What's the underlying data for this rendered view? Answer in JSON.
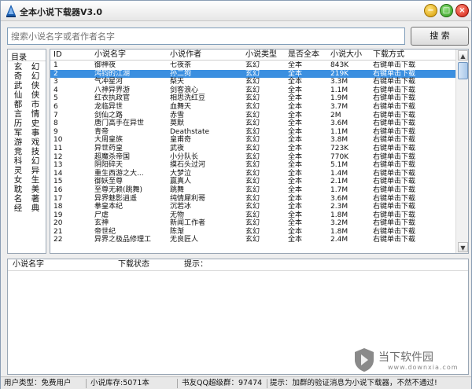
{
  "window": {
    "title": "全本小说下载器V3.0",
    "min_icon": "minimize-icon",
    "max_icon": "maximize-icon",
    "close_icon": "close-icon"
  },
  "search": {
    "placeholder": "搜索小说名字或者作者名字",
    "button_label": "搜 索"
  },
  "categories": {
    "header": "目录",
    "items": [
      "玄",
      "幻",
      "奇",
      "幻",
      "武",
      "侠",
      "仙",
      "侠",
      "都",
      "市",
      "言",
      "情",
      "历",
      "史",
      "军",
      "事",
      "游",
      "戏",
      "竞",
      "技",
      "科",
      "幻",
      "灵",
      "异",
      "女",
      "生",
      "耽",
      "美",
      "名",
      "著",
      "经",
      "典"
    ]
  },
  "list": {
    "columns": [
      "ID",
      "小说名字",
      "小说作者",
      "小说类型",
      "是否全本",
      "小说大小",
      "下载方式"
    ],
    "selected_index": 1,
    "rows": [
      [
        "1",
        "御神夜",
        "七夜茶",
        "玄幻",
        "全本",
        "843K",
        "右键单击下载"
      ],
      [
        "2",
        "鸿钧的江湖",
        "孙二狗",
        "玄幻",
        "全本",
        "219K",
        "右键单击下载"
      ],
      [
        "3",
        "气冲星河",
        "梨天",
        "玄幻",
        "全本",
        "3.3M",
        "右键单击下载"
      ],
      [
        "4",
        "八神异界游",
        "剑客浪心",
        "玄幻",
        "全本",
        "1.1M",
        "右键单击下载"
      ],
      [
        "5",
        "红衣执政官",
        "相思洗红豆",
        "玄幻",
        "全本",
        "1.9M",
        "右键单击下载"
      ],
      [
        "6",
        "龙临异世",
        "血舞天",
        "玄幻",
        "全本",
        "3.7M",
        "右键单击下载"
      ],
      [
        "7",
        "剑仙之路",
        "赤雪",
        "玄幻",
        "全本",
        "2M",
        "右键单击下载"
      ],
      [
        "8",
        "唐门高手在异世",
        "莫默",
        "玄幻",
        "全本",
        "3.6M",
        "右键单击下载"
      ],
      [
        "9",
        "青帝",
        "Deathstate",
        "玄幻",
        "全本",
        "1.1M",
        "右键单击下载"
      ],
      [
        "10",
        "大周皇族",
        "皇甫奇",
        "玄幻",
        "全本",
        "3.8M",
        "右键单击下载"
      ],
      [
        "11",
        "异世药皇",
        "武夜",
        "玄幻",
        "全本",
        "723K",
        "右键单击下载"
      ],
      [
        "12",
        "超魔杀帝国",
        "小分队长",
        "玄幻",
        "全本",
        "770K",
        "右键单击下载"
      ],
      [
        "13",
        "阴阳碎天",
        "摸石头过河",
        "玄幻",
        "全本",
        "5.1M",
        "右键单击下载"
      ],
      [
        "14",
        "重生西游之大...",
        "大梦泣",
        "玄幻",
        "全本",
        "1.4M",
        "右键单击下载"
      ],
      [
        "15",
        "御妖至尊",
        "赢真人",
        "玄幻",
        "全本",
        "2.1M",
        "右键单击下载"
      ],
      [
        "16",
        "至尊无赖(跳舞)",
        "跳舞",
        "玄幻",
        "全本",
        "1.7M",
        "右键单击下载"
      ],
      [
        "17",
        "异界魅影逍遥",
        "纯情犀利哥",
        "玄幻",
        "全本",
        "3.6M",
        "右键单击下载"
      ],
      [
        "18",
        "拳皇本纪",
        "沉若冰",
        "玄幻",
        "全本",
        "2.3M",
        "右键单击下载"
      ],
      [
        "19",
        "尸虐",
        "无物",
        "玄幻",
        "全本",
        "1.8M",
        "右键单击下载"
      ],
      [
        "20",
        "玄神",
        "新闻工作者",
        "玄幻",
        "全本",
        "3.2M",
        "右键单击下载"
      ],
      [
        "21",
        "帝世纪",
        "陈渐",
        "玄幻",
        "全本",
        "1.8M",
        "右键单击下载"
      ],
      [
        "22",
        "异界之极品修理工",
        "无良匠人",
        "玄幻",
        "全本",
        "2.4M",
        "右键单击下载"
      ]
    ]
  },
  "download": {
    "columns": [
      "小说名字",
      "下载状态",
      "提示："
    ]
  },
  "status": {
    "user_type": "用户类型：免费用户",
    "library": "小说库存:5071本",
    "qq_group": "书友QQ超级群：97474",
    "tip": "提示：加群的验证消息为小说下载器，不然不通过!"
  },
  "watermark": {
    "text": "当下软件园",
    "url": "www.downxia.com"
  },
  "colors": {
    "selected_row": "#3b8fe0",
    "min_button": "#d69a00",
    "max_button": "#2f9b1c",
    "close_button": "#d11f10"
  }
}
